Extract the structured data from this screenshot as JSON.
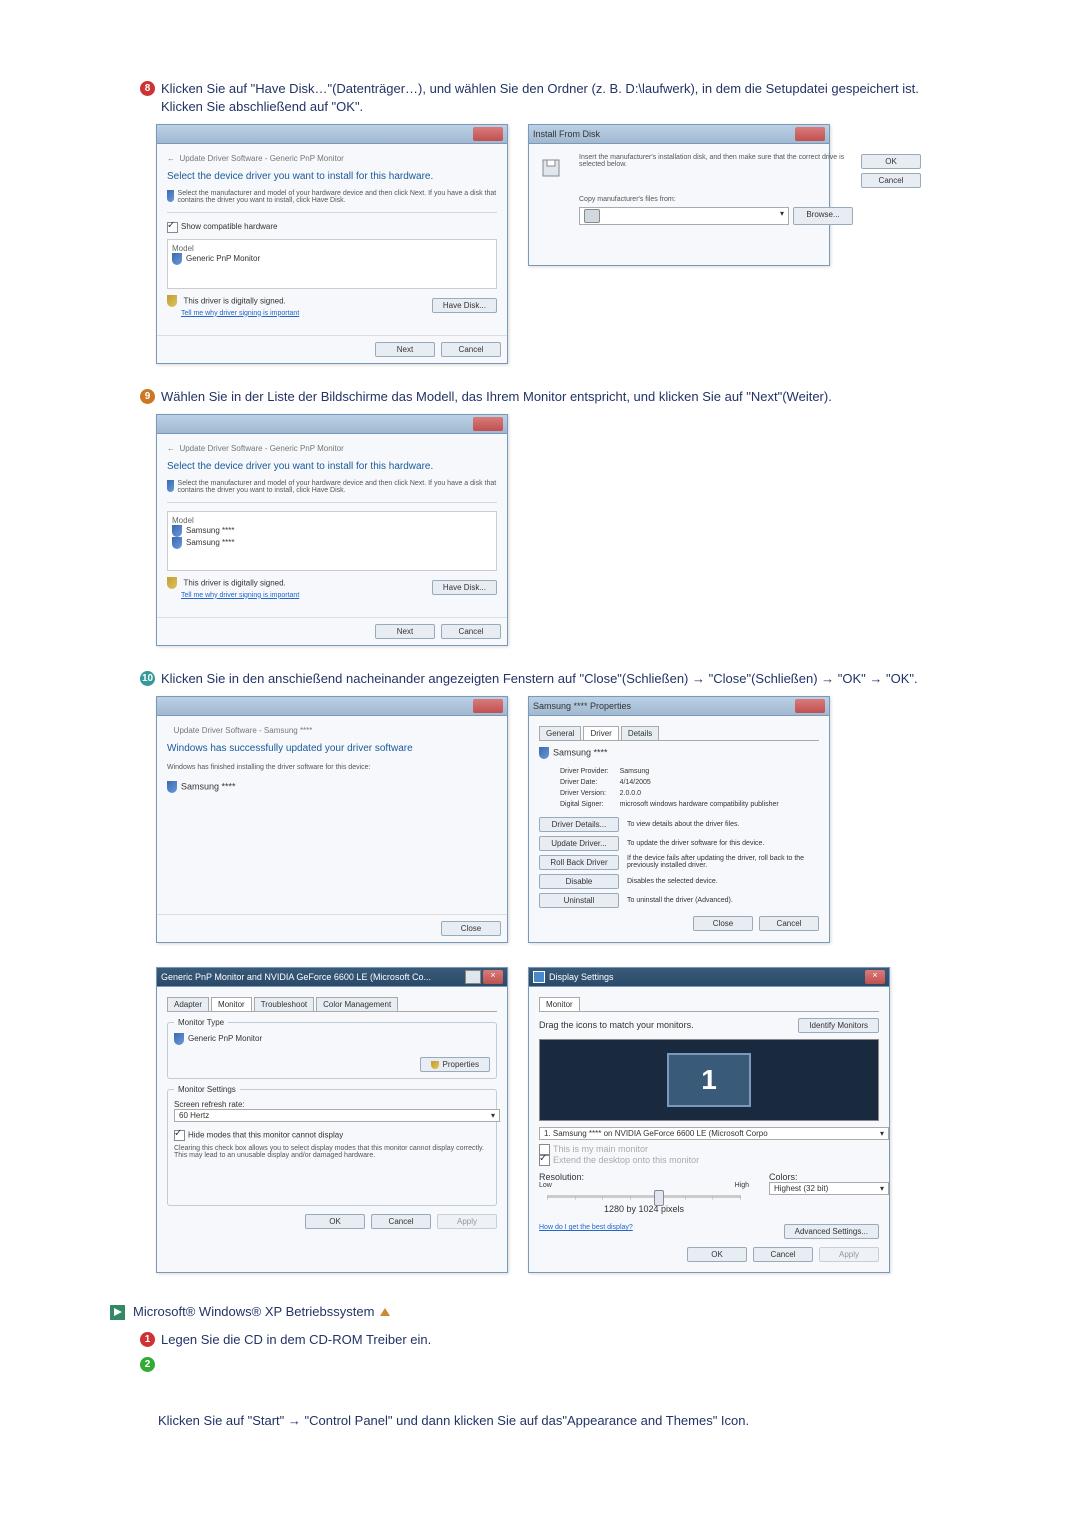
{
  "step8": {
    "text": "Klicken Sie auf \"Have Disk…\"(Datenträger…), und wählen Sie den Ordner (z. B. D:\\laufwerk), in dem die Setupdatei gespeichert ist. Klicken Sie abschließend auf \"OK\".",
    "num": "8"
  },
  "step9": {
    "text": "Wählen Sie in der Liste der Bildschirme das Modell, das Ihrem Monitor entspricht, und klicken Sie auf \"Next\"(Weiter).",
    "num": "9"
  },
  "step10": {
    "text": "Klicken Sie in den anschießend nacheinander angezeigten Fenstern auf \"Close\"(Schließen) → \"Close\"(Schließen) → \"OK\" → \"OK\".",
    "num": "10"
  },
  "xpSection": {
    "title": "Microsoft® Windows® XP Betriebssystem",
    "step1": {
      "num": "1",
      "text": "Legen Sie die CD in dem CD-ROM Treiber ein."
    },
    "step2": {
      "num": "2"
    },
    "paraText": "Klicken Sie auf \"Start\" → \"Control Panel\" und dann klicken Sie auf das\"Appearance and Themes\" Icon."
  },
  "updateDriverA": {
    "title": "Update Driver Software - Generic PnP Monitor",
    "heading": "Select the device driver you want to install for this hardware.",
    "desc": "Select the manufacturer and model of your hardware device and then click Next. If you have a disk that contains the driver you want to install, click Have Disk.",
    "showCompat": "Show compatible hardware",
    "modelCol": "Model",
    "modelItem": "Generic PnP Monitor",
    "signed": "This driver is digitally signed.",
    "signLink": "Tell me why driver signing is important",
    "haveDisk": "Have Disk...",
    "next": "Next",
    "cancel": "Cancel"
  },
  "installFromDisk": {
    "title": "Install From Disk",
    "desc": "Insert the manufacturer's installation disk, and then make sure that the correct drive is selected below.",
    "ok": "OK",
    "cancel": "Cancel",
    "copyLabel": "Copy manufacturer's files from:",
    "browse": "Browse..."
  },
  "updateDriverB": {
    "title": "Update Driver Software - Generic PnP Monitor",
    "heading": "Select the device driver you want to install for this hardware.",
    "desc": "Select the manufacturer and model of your hardware device and then click Next. If you have a disk that contains the driver you want to install, click Have Disk.",
    "modelCol": "Model",
    "modelItem1": "Samsung ****",
    "modelItem2": "Samsung ****",
    "signed": "This driver is digitally signed.",
    "signLink": "Tell me why driver signing is important",
    "haveDisk": "Have Disk...",
    "next": "Next",
    "cancel": "Cancel"
  },
  "updateDriverC": {
    "title": "Update Driver Software - Samsung ****",
    "heading": "Windows has successfully updated your driver software",
    "desc": "Windows has finished installing the driver software for this device:",
    "deviceName": "Samsung ****",
    "close": "Close"
  },
  "propertiesDialog": {
    "title": "Samsung **** Properties",
    "tabGeneral": "General",
    "tabDriver": "Driver",
    "tabDetails": "Details",
    "deviceName": "Samsung ****",
    "providerLabel": "Driver Provider:",
    "providerVal": "Samsung",
    "dateLabel": "Driver Date:",
    "dateVal": "4/14/2005",
    "versionLabel": "Driver Version:",
    "versionVal": "2.0.0.0",
    "signerLabel": "Digital Signer:",
    "signerVal": "microsoft windows hardware compatibility publisher",
    "btnDetails": "Driver Details...",
    "btnDetailsDesc": "To view details about the driver files.",
    "btnUpdate": "Update Driver...",
    "btnUpdateDesc": "To update the driver software for this device.",
    "btnRollback": "Roll Back Driver",
    "btnRollbackDesc": "If the device fails after updating the driver, roll back to the previously installed driver.",
    "btnDisable": "Disable",
    "btnDisableDesc": "Disables the selected device.",
    "btnUninstall": "Uninstall",
    "btnUninstallDesc": "To uninstall the driver (Advanced).",
    "close": "Close",
    "cancel": "Cancel"
  },
  "monitorProps": {
    "title": "Generic PnP Monitor and NVIDIA GeForce 6600 LE (Microsoft Co...",
    "tabAdapter": "Adapter",
    "tabMonitor": "Monitor",
    "tabTrouble": "Troubleshoot",
    "tabColor": "Color Management",
    "typeLabel": "Monitor Type",
    "typeVal": "Generic PnP Monitor",
    "propBtn": "Properties",
    "settingsLabel": "Monitor Settings",
    "refreshLabel": "Screen refresh rate:",
    "refreshVal": "60 Hertz",
    "hideModes": "Hide modes that this monitor cannot display",
    "hideDesc": "Clearing this check box allows you to select display modes that this monitor cannot display correctly. This may lead to an unusable display and/or damaged hardware.",
    "ok": "OK",
    "cancel": "Cancel",
    "apply": "Apply"
  },
  "displaySettings": {
    "title": "Display Settings",
    "tabMonitor": "Monitor",
    "dragLabel": "Drag the icons to match your monitors.",
    "identify": "Identify Monitors",
    "dispNum": "1",
    "selectLabel": "1. Samsung **** on NVIDIA GeForce 6600 LE (Microsoft Corpo",
    "mainChk": "This is my main monitor",
    "extendChk": "Extend the desktop onto this monitor",
    "resLabel": "Resolution:",
    "low": "Low",
    "high": "High",
    "resVal": "1280 by 1024 pixels",
    "colorsLabel": "Colors:",
    "colorsVal": "Highest (32 bit)",
    "bestLink": "How do I get the best display?",
    "advanced": "Advanced Settings...",
    "ok": "OK",
    "cancel": "Cancel",
    "apply": "Apply"
  }
}
